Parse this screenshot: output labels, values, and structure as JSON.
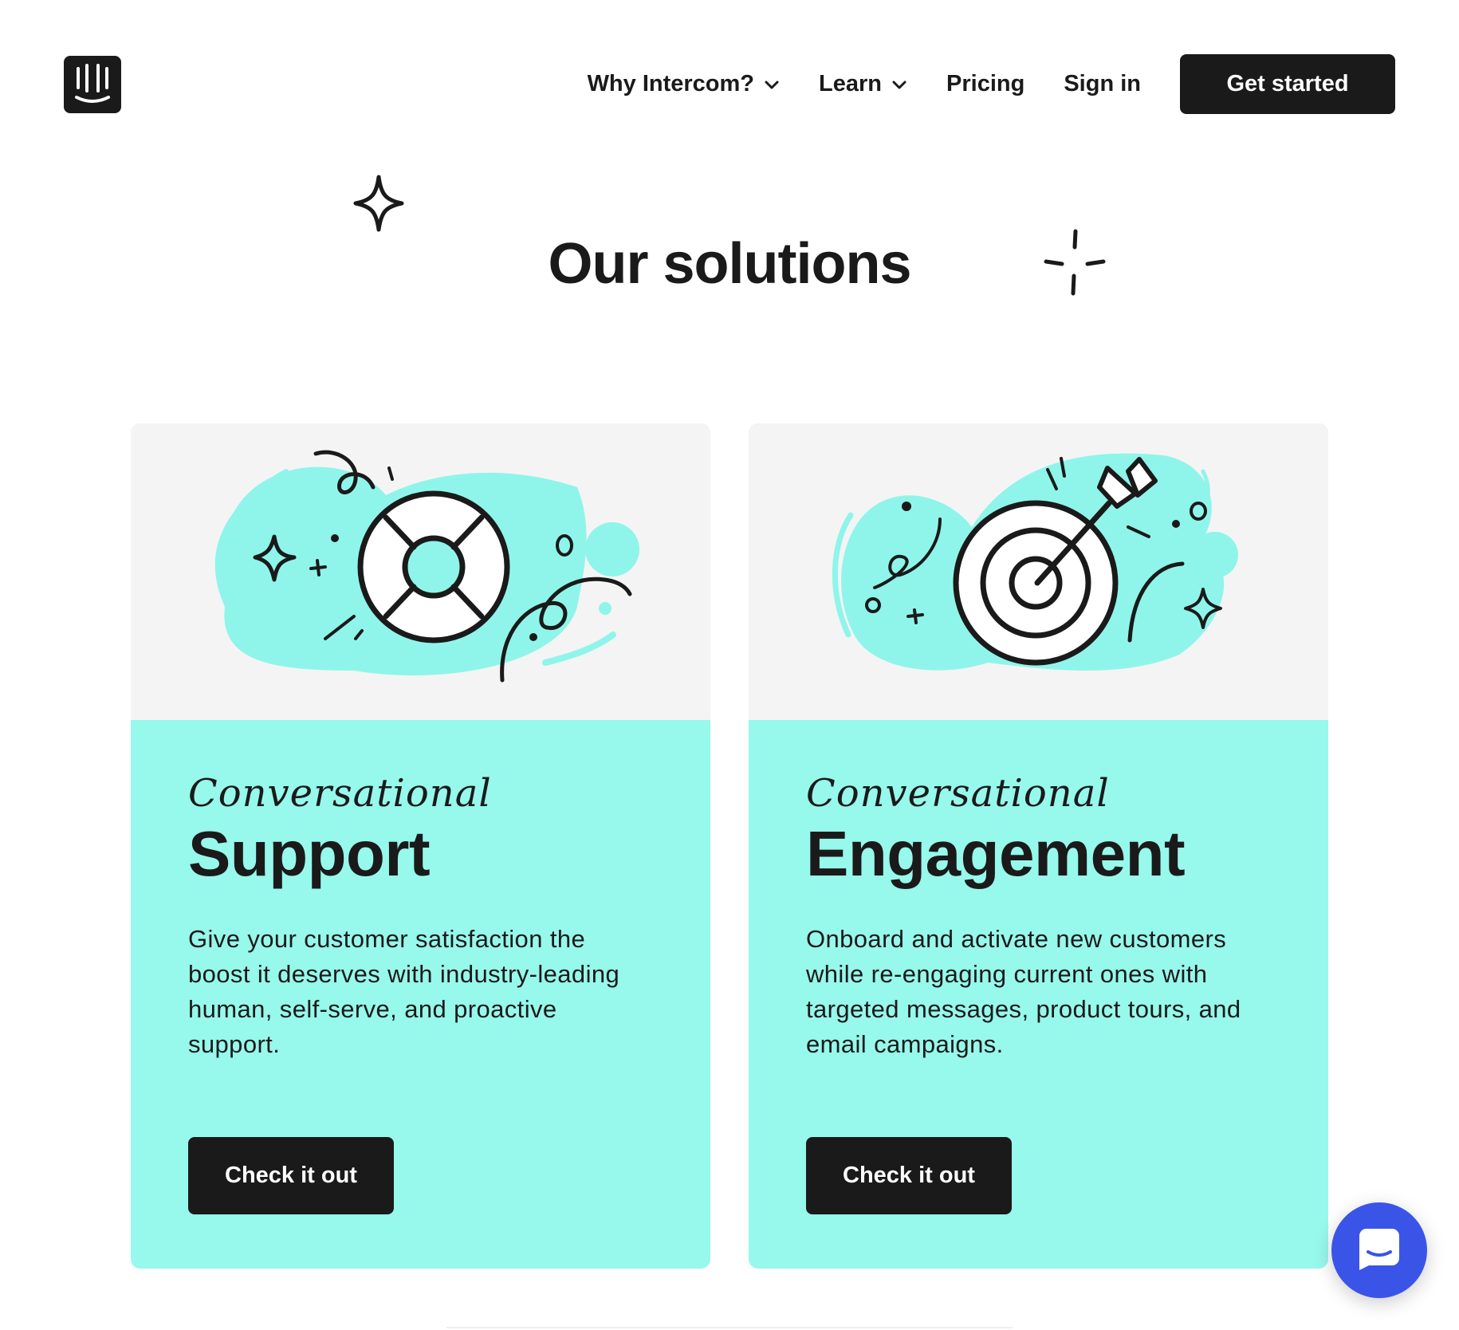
{
  "header": {
    "logo_icon": "intercom-logo-icon",
    "nav": [
      {
        "label": "Why Intercom?",
        "has_dropdown": true
      },
      {
        "label": "Learn",
        "has_dropdown": true
      },
      {
        "label": "Pricing",
        "has_dropdown": false
      },
      {
        "label": "Sign in",
        "has_dropdown": false
      }
    ],
    "cta_label": "Get started"
  },
  "section": {
    "title": "Our solutions"
  },
  "cards": [
    {
      "eyebrow": "Conversational",
      "title": "Support",
      "description": "Give your customer satisfaction the boost it deserves with industry-leading human, self-serve, and proactive support.",
      "button_label": "Check it out",
      "illustration": "lifebuoy-illustration"
    },
    {
      "eyebrow": "Conversational",
      "title": "Engagement",
      "description": "Onboard and activate new customers while re-engaging current ones with targeted messages, product tours, and email campaigns.",
      "button_label": "Check it out",
      "illustration": "target-illustration"
    }
  ],
  "launcher": {
    "icon": "messenger-icon"
  },
  "colors": {
    "text": "#1a1a1a",
    "card_accent": "#97f8ec",
    "media_bg": "#f4f4f4",
    "illustration_blob": "#8ff5ea",
    "launcher": "#3a54e8"
  }
}
